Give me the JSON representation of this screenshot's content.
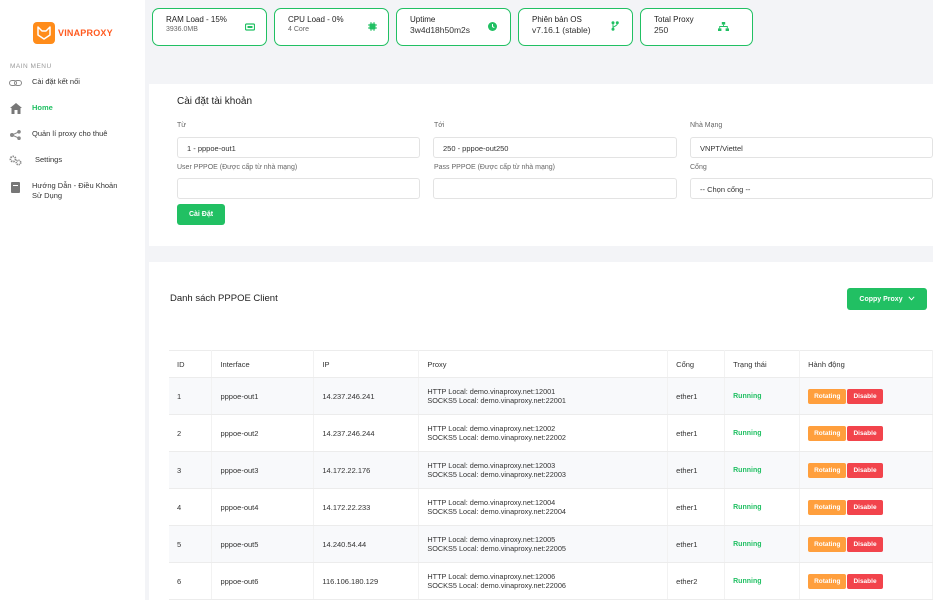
{
  "brand": {
    "name": "VINAPROXY"
  },
  "sidebar": {
    "menu_label": "MAIN MENU",
    "items": [
      {
        "label": "Cài đặt kết nối",
        "icon": "link-icon"
      },
      {
        "label": "Home",
        "icon": "home-icon",
        "active": true
      },
      {
        "label": "Quản lí proxy cho thuê",
        "icon": "share-icon"
      },
      {
        "label": "Settings",
        "icon": "gears-icon"
      },
      {
        "label": "Hướng Dẫn - Điều Khoản Sử Dụng",
        "icon": "book-icon"
      }
    ]
  },
  "stats": [
    {
      "title": "RAM Load - 15%",
      "value": "3936.0MB",
      "icon": "memory-icon"
    },
    {
      "title": "CPU Load - 0%",
      "value": "4 Core",
      "icon": "cpu-icon"
    },
    {
      "title": "Uptime",
      "value": "3w4d18h50m2s",
      "icon": "clock-icon"
    },
    {
      "title": "Phiên bản OS",
      "value": "v7.16.1 (stable)",
      "icon": "branch-icon"
    },
    {
      "title": "Total Proxy",
      "value": "250",
      "icon": "network-icon"
    }
  ],
  "settings": {
    "title": "Cài đặt tài khoản",
    "from_label": "Từ",
    "from_value": "1 - pppoe-out1",
    "to_label": "Tới",
    "to_value": "250 - pppoe-out250",
    "isp_label": "Nhà Mạng",
    "isp_value": "VNPT/Viettel",
    "user_label": "User PPPOE (Được cấp từ nhà mạng)",
    "user_value": "",
    "pass_label": "Pass PPPOE (Được cấp từ nhà mạng)",
    "pass_value": "",
    "port_label": "Cổng",
    "port_value": "-- Chọn cổng --",
    "submit_label": "Cài Đặt"
  },
  "clients": {
    "title": "Danh sách PPPOE Client",
    "copy_label": "Coppy Proxy",
    "headers": [
      "ID",
      "Interface",
      "IP",
      "Proxy",
      "Cổng",
      "Trạng thái",
      "Hành động"
    ],
    "rotate_label": "Rotating",
    "disable_label": "Disable",
    "rows": [
      {
        "id": "1",
        "iface": "pppoe-out1",
        "ip": "14.237.246.241",
        "http": "HTTP Local: demo.vinaproxy.net:12001",
        "socks": "SOCKS5 Local: demo.vinaproxy.net:22001",
        "port": "ether1",
        "status": "Running"
      },
      {
        "id": "2",
        "iface": "pppoe-out2",
        "ip": "14.237.246.244",
        "http": "HTTP Local: demo.vinaproxy.net:12002",
        "socks": "SOCKS5 Local: demo.vinaproxy.net:22002",
        "port": "ether1",
        "status": "Running"
      },
      {
        "id": "3",
        "iface": "pppoe-out3",
        "ip": "14.172.22.176",
        "http": "HTTP Local: demo.vinaproxy.net:12003",
        "socks": "SOCKS5 Local: demo.vinaproxy.net:22003",
        "port": "ether1",
        "status": "Running"
      },
      {
        "id": "4",
        "iface": "pppoe-out4",
        "ip": "14.172.22.233",
        "http": "HTTP Local: demo.vinaproxy.net:12004",
        "socks": "SOCKS5 Local: demo.vinaproxy.net:22004",
        "port": "ether1",
        "status": "Running"
      },
      {
        "id": "5",
        "iface": "pppoe-out5",
        "ip": "14.240.54.44",
        "http": "HTTP Local: demo.vinaproxy.net:12005",
        "socks": "SOCKS5 Local: demo.vinaproxy.net:22005",
        "port": "ether1",
        "status": "Running"
      },
      {
        "id": "6",
        "iface": "pppoe-out6",
        "ip": "116.106.180.129",
        "http": "HTTP Local: demo.vinaproxy.net:12006",
        "socks": "SOCKS5 Local: demo.vinaproxy.net:22006",
        "port": "ether2",
        "status": "Running"
      }
    ]
  },
  "colors": {
    "accent": "#21c063",
    "brand": "#ff5a1f",
    "rotate": "#ff9f3d",
    "disable": "#f2444c"
  }
}
